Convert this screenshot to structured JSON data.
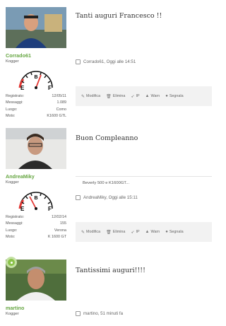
{
  "posts": [
    {
      "username": "Corrado61",
      "rank": "Kogger",
      "title": "Tanti auguri Francesco !!",
      "meta": "Corrado61, Oggi alle 14:51",
      "extra": "",
      "info": [
        {
          "label": "Registrato:",
          "value": "12/05/11"
        },
        {
          "label": "Messaggi:",
          "value": "1.089"
        },
        {
          "label": "Luogo:",
          "value": "Como"
        },
        {
          "label": "Moto:",
          "value": "K1600 GTL"
        }
      ]
    },
    {
      "username": "AndreaMiky",
      "rank": "Kogger",
      "title": "Buon Compleanno",
      "meta": "AndreaMiky, Oggi alle 15:11",
      "extra": "Beverly 500 e K1600GT...",
      "info": [
        {
          "label": "Registrato:",
          "value": "12/02/14"
        },
        {
          "label": "Messaggi:",
          "value": "155"
        },
        {
          "label": "Luogo:",
          "value": "Verona"
        },
        {
          "label": "Moto:",
          "value": "K 1600 GT"
        }
      ]
    },
    {
      "username": "martino",
      "rank": "Kogger",
      "title": "Tantissimi auguri!!!!",
      "meta": "martino, 51 minuti fa",
      "extra": "",
      "info": []
    }
  ],
  "gauge": {
    "empty_label": "E",
    "full_label": "F",
    "center_label": "B"
  },
  "actions": [
    {
      "icon": "pencil-icon",
      "glyph": "✎",
      "label": "Modifica"
    },
    {
      "icon": "trash-icon",
      "glyph": "🗑",
      "label": "Elimina"
    },
    {
      "icon": "ip-arrow-icon",
      "glyph": "➶",
      "label": "IP"
    },
    {
      "icon": "warning-icon",
      "glyph": "▲",
      "label": "Warn"
    },
    {
      "icon": "report-icon",
      "glyph": "●",
      "label": "Segnala"
    }
  ],
  "colors": {
    "username": "#66a642",
    "action_bar": "#f2f2f2",
    "online_dot": "#8bc34a"
  }
}
